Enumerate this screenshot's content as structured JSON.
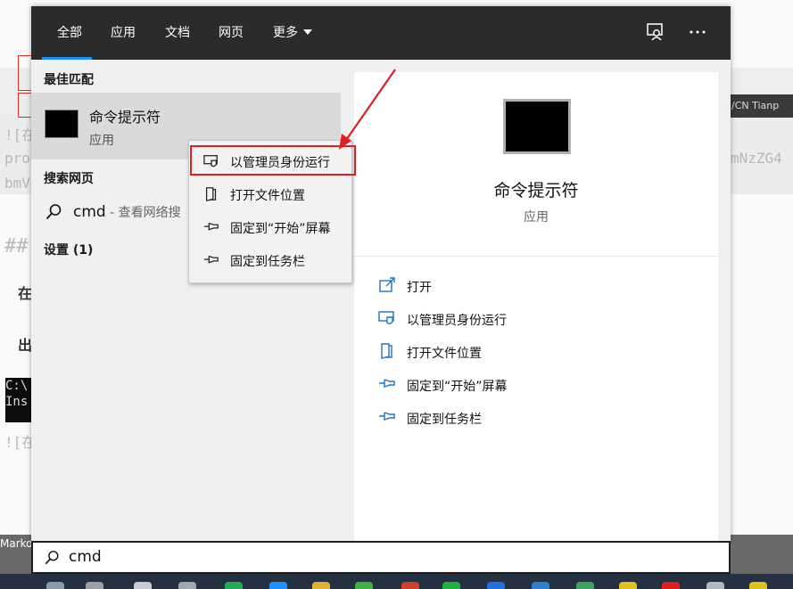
{
  "tabs": [
    "全部",
    "应用",
    "文档",
    "网页",
    "更多"
  ],
  "sections": {
    "best_match": "最佳匹配",
    "search_web": "搜索网页",
    "settings": "设置 (1)"
  },
  "best_match_item": {
    "title": "命令提示符",
    "subtitle": "应用"
  },
  "web_result": {
    "query": "cmd",
    "suffix": " - 查看网络搜"
  },
  "context_menu": [
    {
      "label": "以管理员身份运行",
      "icon": "shield-icon"
    },
    {
      "label": "打开文件位置",
      "icon": "folder-icon"
    },
    {
      "label": "固定到“开始”屏幕",
      "icon": "pin-icon"
    },
    {
      "label": "固定到任务栏",
      "icon": "pin-icon"
    }
  ],
  "detail": {
    "title": "命令提示符",
    "subtitle": "应用",
    "actions": [
      {
        "label": "打开",
        "icon": "open-icon"
      },
      {
        "label": "以管理员身份运行",
        "icon": "shield-icon"
      },
      {
        "label": "打开文件位置",
        "icon": "folder-icon"
      },
      {
        "label": "固定到“开始”屏幕",
        "icon": "pin-icon"
      },
      {
        "label": "固定到任务栏",
        "icon": "pin-icon"
      }
    ]
  },
  "search": {
    "value": "cmd"
  },
  "background": {
    "line1": "![在",
    "line2": "proc",
    "line3": "bmV",
    "line4": "##",
    "bold1": "在",
    "bold2": "出",
    "term1": "C:\\",
    "term2": "Ins",
    "line5": "![在",
    "right_line": "mNzZG4",
    "status_label": "Marko",
    "dark_label": "/CN Tianp"
  },
  "colors": {
    "accent": "#1e90ff",
    "annotation": "#e02020",
    "topbar": "#2b2b2b"
  }
}
